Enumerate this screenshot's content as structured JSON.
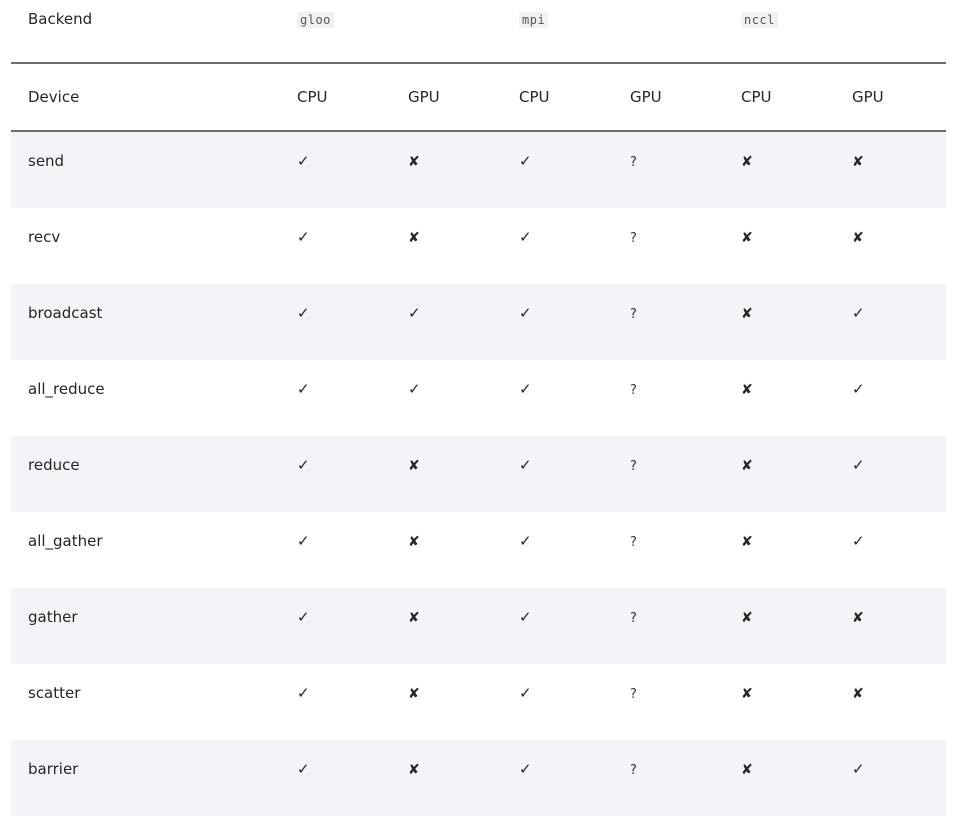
{
  "backend_row": {
    "label": "Backend",
    "backends": [
      "gloo",
      "mpi",
      "nccl"
    ]
  },
  "device_row": {
    "label": "Device",
    "devices": [
      "CPU",
      "GPU",
      "CPU",
      "GPU",
      "CPU",
      "GPU"
    ]
  },
  "symbols": {
    "yes": "✓",
    "no": "✘",
    "unknown": "?"
  },
  "rows": [
    {
      "op": "send",
      "marks": [
        "✓",
        "✘",
        "✓",
        "?",
        "✘",
        "✘"
      ]
    },
    {
      "op": "recv",
      "marks": [
        "✓",
        "✘",
        "✓",
        "?",
        "✘",
        "✘"
      ]
    },
    {
      "op": "broadcast",
      "marks": [
        "✓",
        "✓",
        "✓",
        "?",
        "✘",
        "✓"
      ]
    },
    {
      "op": "all_reduce",
      "marks": [
        "✓",
        "✓",
        "✓",
        "?",
        "✘",
        "✓"
      ]
    },
    {
      "op": "reduce",
      "marks": [
        "✓",
        "✘",
        "✓",
        "?",
        "✘",
        "✓"
      ]
    },
    {
      "op": "all_gather",
      "marks": [
        "✓",
        "✘",
        "✓",
        "?",
        "✘",
        "✓"
      ]
    },
    {
      "op": "gather",
      "marks": [
        "✓",
        "✘",
        "✓",
        "?",
        "✘",
        "✘"
      ]
    },
    {
      "op": "scatter",
      "marks": [
        "✓",
        "✘",
        "✓",
        "?",
        "✘",
        "✘"
      ]
    },
    {
      "op": "barrier",
      "marks": [
        "✓",
        "✘",
        "✓",
        "?",
        "✘",
        "✓"
      ]
    }
  ]
}
